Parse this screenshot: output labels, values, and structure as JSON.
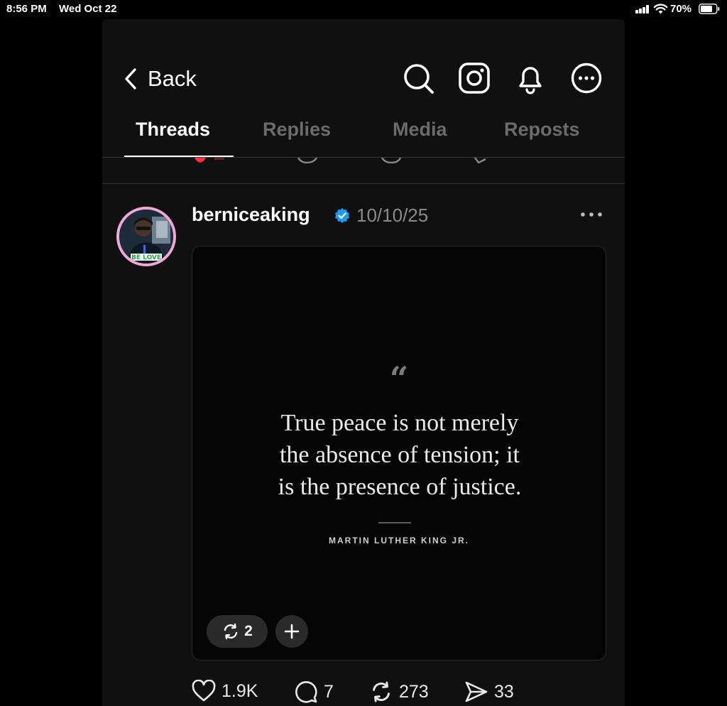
{
  "status_bar": {
    "time": "8:56 PM",
    "date": "Wed Oct 22",
    "battery_pct": "70%"
  },
  "header": {
    "back_label": "Back"
  },
  "tabs": [
    {
      "label": "Threads",
      "active": true
    },
    {
      "label": "Replies",
      "active": false
    },
    {
      "label": "Media",
      "active": false
    },
    {
      "label": "Reposts",
      "active": false
    }
  ],
  "post": {
    "username": "berniceaking",
    "verified": true,
    "date": "10/10/25",
    "avatar_caption": "BE LOVE",
    "quote_mark": "“",
    "quote_line_1": "True peace is not merely",
    "quote_line_2": "the absence of tension; it",
    "quote_line_3": "is the presence of justice.",
    "quote_author": "MARTIN LUTHER KING JR.",
    "reposts_badge": "2",
    "likes": "1.9K",
    "replies": "7",
    "reposts": "273",
    "shares": "33"
  },
  "colors": {
    "panel": "#101010",
    "accent_verified": "#1d9bf0",
    "avatar_ring": "#f0a8d8",
    "peek_like": "#ff3040"
  },
  "icons": [
    "chevron-left-icon",
    "search-icon",
    "instagram-icon",
    "bell-icon",
    "more-circle-icon",
    "verified-icon",
    "more-dots-icon",
    "repost-icon",
    "plus-icon",
    "heart-icon",
    "comment-icon",
    "send-icon"
  ]
}
